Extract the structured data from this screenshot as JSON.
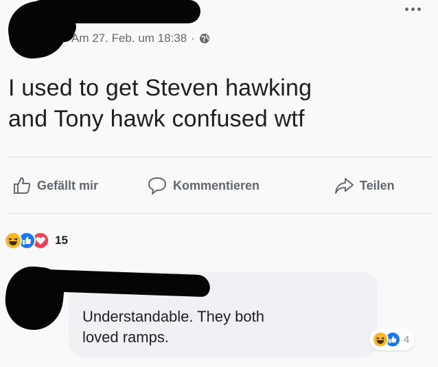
{
  "post": {
    "timestamp": "Am 27. Feb. um 18:38",
    "separator": "·",
    "privacy_icon": "globe-icon",
    "text_line1": "I used to get Steven hawking",
    "text_line2": "and Tony hawk confused wtf",
    "more_icon": "more-icon"
  },
  "actions": {
    "like_label": "Gefällt mir",
    "comment_label": "Kommentieren",
    "share_label": "Teilen"
  },
  "reactions": {
    "icons": [
      "haha-icon",
      "like-icon",
      "love-icon"
    ],
    "count": "15"
  },
  "comment": {
    "text_line1": "Understandable. They both",
    "text_line2": "loved ramps.",
    "reaction_icons": [
      "haha-icon",
      "like-icon"
    ],
    "reaction_count": "4"
  },
  "colors": {
    "like_blue": "#1877f2",
    "love_red": "#f33e58",
    "haha_yellow": "#f7b928",
    "secondary_text": "#606770"
  }
}
